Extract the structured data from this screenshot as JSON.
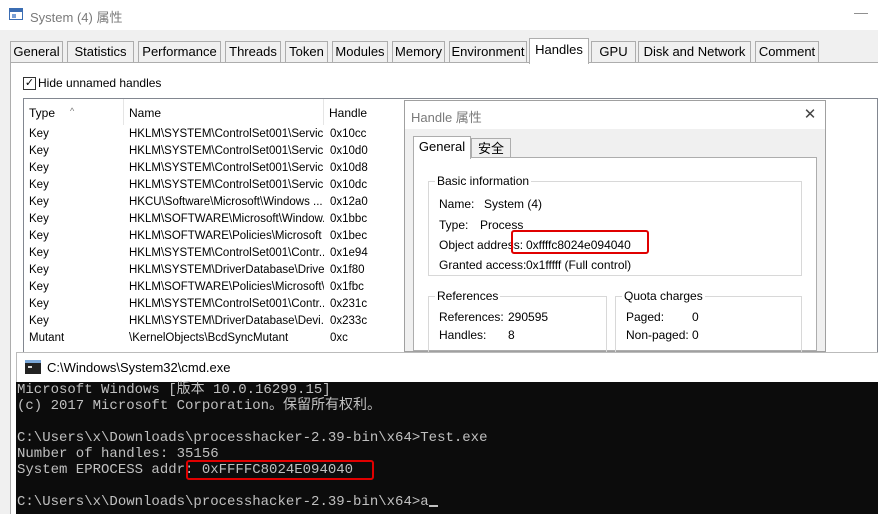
{
  "main_window": {
    "title": "System (4) 属性",
    "tabs": [
      "General",
      "Statistics",
      "Performance",
      "Threads",
      "Token",
      "Modules",
      "Memory",
      "Environment",
      "Handles",
      "GPU",
      "Disk and Network",
      "Comment"
    ],
    "active_tab": "Handles",
    "hide_unnamed_label": "Hide unnamed handles",
    "hide_unnamed_checked": "✓",
    "columns": {
      "type": "Type",
      "name": "Name",
      "handle": "Handle"
    },
    "rows": [
      {
        "type": "Key",
        "name": "HKLM\\SYSTEM\\ControlSet001\\Servic...",
        "handle": "0x10cc"
      },
      {
        "type": "Key",
        "name": "HKLM\\SYSTEM\\ControlSet001\\Servic...",
        "handle": "0x10d0"
      },
      {
        "type": "Key",
        "name": "HKLM\\SYSTEM\\ControlSet001\\Servic...",
        "handle": "0x10d8"
      },
      {
        "type": "Key",
        "name": "HKLM\\SYSTEM\\ControlSet001\\Servic...",
        "handle": "0x10dc"
      },
      {
        "type": "Key",
        "name": "HKCU\\Software\\Microsoft\\Windows ...",
        "handle": "0x12a0"
      },
      {
        "type": "Key",
        "name": "HKLM\\SOFTWARE\\Microsoft\\Window...",
        "handle": "0x1bbc"
      },
      {
        "type": "Key",
        "name": "HKLM\\SOFTWARE\\Policies\\Microsoft",
        "handle": "0x1bec"
      },
      {
        "type": "Key",
        "name": "HKLM\\SYSTEM\\ControlSet001\\Contr...",
        "handle": "0x1e94"
      },
      {
        "type": "Key",
        "name": "HKLM\\SYSTEM\\DriverDatabase\\Drive...",
        "handle": "0x1f80"
      },
      {
        "type": "Key",
        "name": "HKLM\\SOFTWARE\\Policies\\Microsoft\\...",
        "handle": "0x1fbc"
      },
      {
        "type": "Key",
        "name": "HKLM\\SYSTEM\\ControlSet001\\Contr...",
        "handle": "0x231c"
      },
      {
        "type": "Key",
        "name": "HKLM\\SYSTEM\\DriverDatabase\\Devi...",
        "handle": "0x233c"
      },
      {
        "type": "Mutant",
        "name": "\\KernelObjects\\BcdSyncMutant",
        "handle": "0xc"
      }
    ]
  },
  "handle_dialog": {
    "title": "Handle 属性",
    "close_glyph": "✕",
    "tabs": [
      "General",
      "安全"
    ],
    "basic_info": {
      "title": "Basic information",
      "name_label": "Name:",
      "name_value": "System (4)",
      "type_label": "Type:",
      "type_value": "Process",
      "object_address_label": "Object address:",
      "object_address_value": "0xffffc8024e094040",
      "granted_access_label": "Granted access:",
      "granted_access_value": "0x1fffff (Full control)"
    },
    "references": {
      "title": "References",
      "references_label": "References:",
      "references_value": "290595",
      "handles_label": "Handles:",
      "handles_value": "8"
    },
    "quota": {
      "title": "Quota charges",
      "paged_label": "Paged:",
      "paged_value": "0",
      "nonpaged_label": "Non-paged:",
      "nonpaged_value": "0"
    }
  },
  "cmd": {
    "title": "C:\\Windows\\System32\\cmd.exe",
    "lines": [
      "Microsoft Windows [版本 10.0.16299.15]",
      "(c) 2017 Microsoft Corporation。保留所有权利。",
      "",
      "C:\\Users\\x\\Downloads\\processhacker-2.39-bin\\x64>Test.exe",
      "Number of handles: 35156",
      "System EPROCESS addr: 0xFFFFC8024E094040",
      "",
      "C:\\Users\\x\\Downloads\\processhacker-2.39-bin\\x64>a"
    ]
  },
  "highlight_color": "#e00000"
}
